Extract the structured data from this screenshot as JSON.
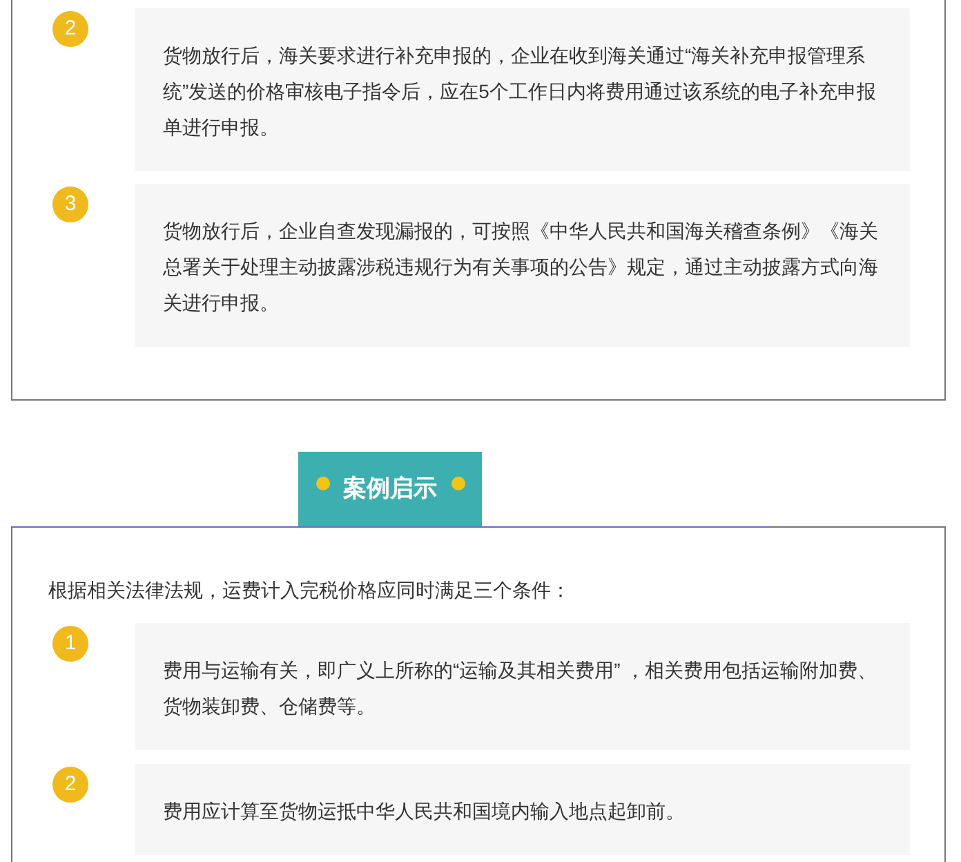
{
  "top_section": {
    "items": [
      {
        "number": "2",
        "text": "货物放行后，海关要求进行补充申报的，企业在收到海关通过“海关补充申报管理系统”发送的价格审核电子指令后，应在5个工作日内将费用通过该系统的电子补充申报单进行申报。"
      },
      {
        "number": "3",
        "text": "货物放行后，企业自查发现漏报的，可按照《中华人民共和国海关稽查条例》《海关总署关于处理主动披露涉税违规行为有关事项的公告》规定，通过主动披露方式向海关进行申报。"
      }
    ]
  },
  "header": {
    "title": "案例启示"
  },
  "bottom_section": {
    "intro": "根据相关法律法规，运费计入完税价格应同时满足三个条件：",
    "items": [
      {
        "number": "1",
        "text": "费用与运输有关，即广义上所称的“运输及其相关费用” ，相关费用包括运输附加费、货物装卸费、仓储费等。"
      },
      {
        "number": "2",
        "text": "费用应计算至货物运抵中华人民共和国境内输入地点起卸前。"
      }
    ]
  }
}
